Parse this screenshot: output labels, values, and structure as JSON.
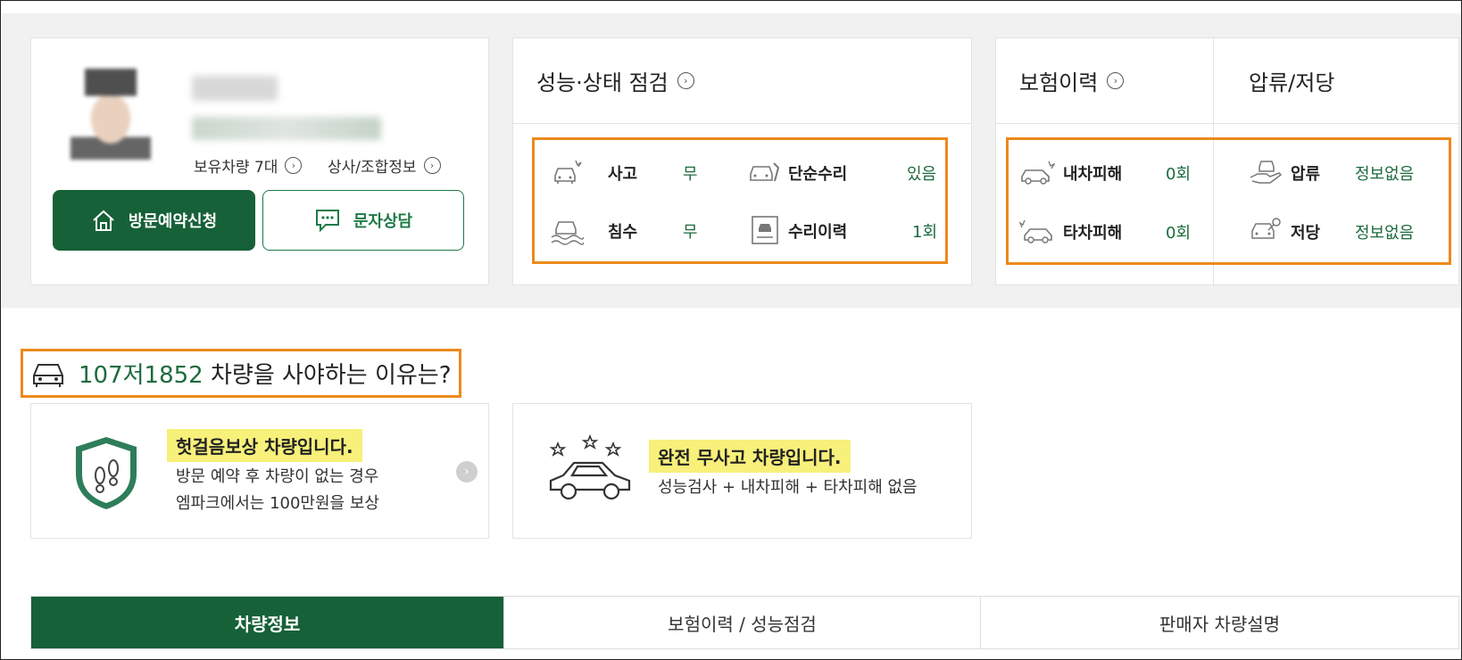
{
  "seller": {
    "stats": {
      "cars_label": "보유차량 7대",
      "company_label": "상사/조합정보"
    },
    "visit_button": "방문예약신청",
    "sms_button": "문자상담"
  },
  "performance": {
    "title": "성능·상태 점검",
    "items": [
      {
        "label": "사고",
        "value": "무",
        "icon": "car-accident-icon"
      },
      {
        "label": "단순수리",
        "value": "있음",
        "icon": "car-repair-icon"
      },
      {
        "label": "침수",
        "value": "무",
        "icon": "car-flood-icon"
      },
      {
        "label": "수리이력",
        "value": "1회",
        "icon": "repair-document-icon"
      }
    ]
  },
  "insurance": {
    "title": "보험이력",
    "items": [
      {
        "label": "내차피해",
        "value": "0회",
        "icon": "my-car-damage-icon"
      },
      {
        "label": "타차피해",
        "value": "0회",
        "icon": "other-car-damage-icon"
      }
    ]
  },
  "seizure": {
    "title": "압류/저당",
    "items": [
      {
        "label": "압류",
        "value": "정보없음",
        "icon": "seizure-hand-car-icon"
      },
      {
        "label": "저당",
        "value": "정보없음",
        "icon": "mortgage-car-icon"
      }
    ]
  },
  "reasons": {
    "plate": "107저1852",
    "title_suffix": "차량을 사야하는 이유는?",
    "cards": [
      {
        "headline": "헛걸음보상 차량입니다.",
        "line1": "방문 예약 후 차량이 없는 경우",
        "line2": "엠파크에서는 100만원을 보상",
        "icon": "footprint-shield-icon"
      },
      {
        "headline": "완전 무사고 차량입니다.",
        "line1": "성능검사 + 내차피해 + 타차피해 없음",
        "icon": "star-car-icon"
      }
    ]
  },
  "tabs": [
    {
      "label": "차량정보",
      "active": true
    },
    {
      "label": "보험이력 / 성능점검",
      "active": false
    },
    {
      "label": "판매자 차량설명",
      "active": false
    }
  ],
  "colors": {
    "brand_green": "#166138",
    "value_green": "#1d6b3d",
    "highlight_orange": "#ec8a1c",
    "highlight_yellow": "#f7f07a"
  }
}
